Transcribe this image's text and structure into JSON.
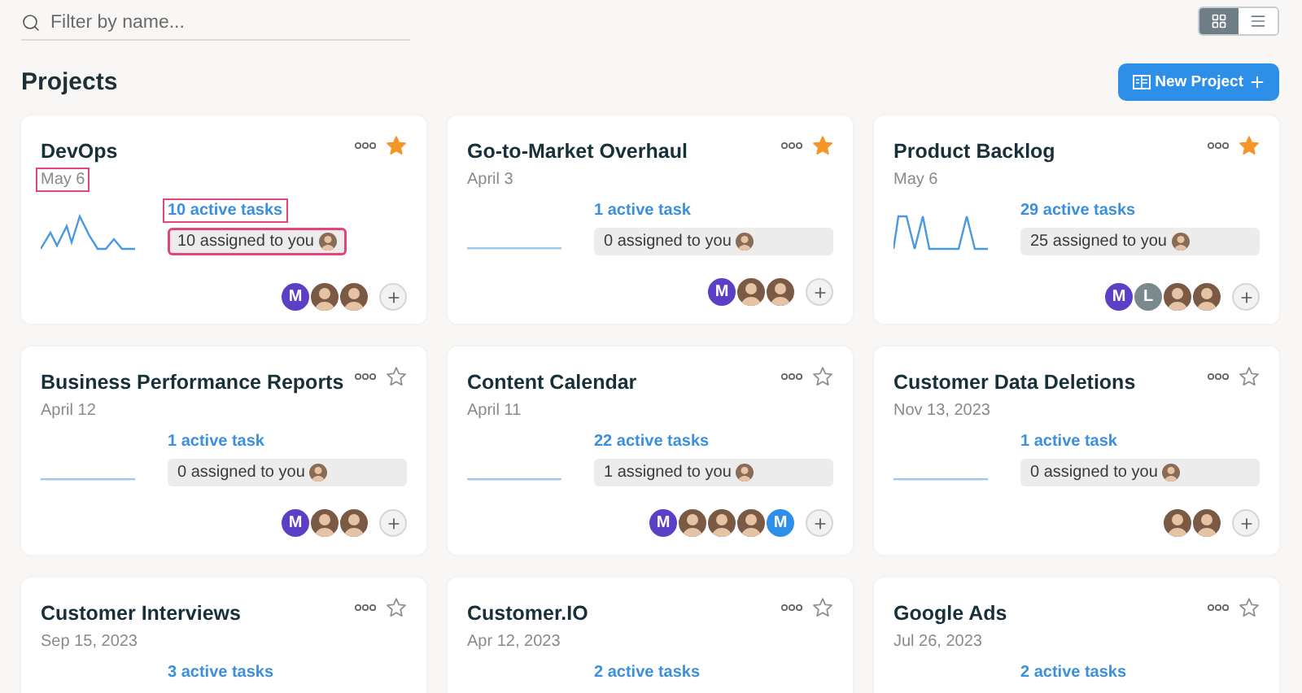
{
  "search": {
    "placeholder": "Filter by name..."
  },
  "view_toggle": [
    {
      "kind": "grid",
      "selected": true
    },
    {
      "kind": "list",
      "selected": false
    }
  ],
  "title": "Projects",
  "new_project_button": {
    "label": "New Project"
  },
  "projects": [
    {
      "name": "DevOps",
      "date": "May 6",
      "starred": true,
      "kind": "jagged",
      "active_tasks": "10 active tasks",
      "assigned": "10 assigned to you",
      "highlight_date": true,
      "highlight_tasks": true,
      "highlight_assigned": true,
      "members": [
        {
          "kind": "letter",
          "letter": "M",
          "color": "#5b3fc4"
        },
        {
          "kind": "photo"
        },
        {
          "kind": "photo"
        }
      ]
    },
    {
      "name": "Go-to-Market Overhaul",
      "date": "April 3",
      "starred": true,
      "kind": "flat",
      "active_tasks": "1 active task",
      "assigned": "0 assigned to you",
      "highlight_date": false,
      "highlight_tasks": false,
      "highlight_assigned": false,
      "members": [
        {
          "kind": "letter",
          "letter": "M",
          "color": "#5b3fc4"
        },
        {
          "kind": "photo"
        },
        {
          "kind": "photo"
        }
      ]
    },
    {
      "name": "Product Backlog",
      "date": "May 6",
      "starred": true,
      "kind": "spiky",
      "active_tasks": "29 active tasks",
      "assigned": "25 assigned to you",
      "highlight_date": false,
      "highlight_tasks": false,
      "highlight_assigned": false,
      "members": [
        {
          "kind": "letter",
          "letter": "M",
          "color": "#5b3fc4"
        },
        {
          "kind": "letter",
          "letter": "L",
          "color": "#7a8a8c"
        },
        {
          "kind": "photo"
        },
        {
          "kind": "photo"
        }
      ]
    },
    {
      "name": "Business Performance Reports",
      "date": "April 12",
      "starred": false,
      "kind": "flat",
      "active_tasks": "1 active task",
      "assigned": "0 assigned to you",
      "highlight_date": false,
      "highlight_tasks": false,
      "highlight_assigned": false,
      "members": [
        {
          "kind": "letter",
          "letter": "M",
          "color": "#5b3fc4"
        },
        {
          "kind": "photo"
        },
        {
          "kind": "photo"
        }
      ]
    },
    {
      "name": "Content Calendar",
      "date": "April 11",
      "starred": false,
      "kind": "flat",
      "active_tasks": "22 active tasks",
      "assigned": "1 assigned to you",
      "highlight_date": false,
      "highlight_tasks": false,
      "highlight_assigned": false,
      "members": [
        {
          "kind": "letter",
          "letter": "M",
          "color": "#5b3fc4"
        },
        {
          "kind": "photo"
        },
        {
          "kind": "photo"
        },
        {
          "kind": "photo"
        },
        {
          "kind": "letter",
          "letter": "M",
          "color": "#2d8fe8"
        }
      ]
    },
    {
      "name": "Customer Data Deletions",
      "date": "Nov 13, 2023",
      "starred": false,
      "kind": "flat",
      "active_tasks": "1 active task",
      "assigned": "0 assigned to you",
      "highlight_date": false,
      "highlight_tasks": false,
      "highlight_assigned": false,
      "members": [
        {
          "kind": "photo"
        },
        {
          "kind": "photo"
        }
      ]
    },
    {
      "name": "Customer Interviews",
      "date": "Sep 15, 2023",
      "starred": false,
      "kind": "cut",
      "active_tasks": "3 active tasks",
      "highlight_date": false,
      "highlight_tasks": false
    },
    {
      "name": "Customer.IO",
      "date": "Apr 12, 2023",
      "starred": false,
      "kind": "cut",
      "active_tasks": "2 active tasks",
      "highlight_date": false,
      "highlight_tasks": false
    },
    {
      "name": "Google Ads",
      "date": "Jul 26, 2023",
      "starred": false,
      "kind": "cut",
      "active_tasks": "2 active tasks",
      "highlight_date": false,
      "highlight_tasks": false
    }
  ]
}
